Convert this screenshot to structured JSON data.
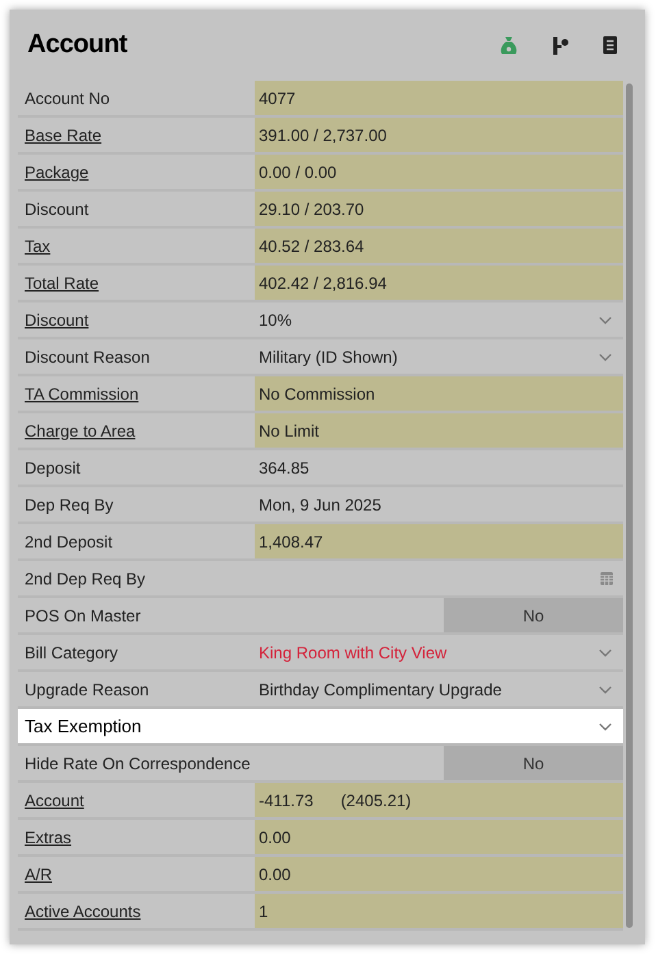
{
  "title": "Account",
  "rows": [
    {
      "label": "Account No",
      "link": false,
      "kind": "text",
      "value": "4077",
      "shaded": true,
      "alert": false,
      "focused": false
    },
    {
      "label": "Base Rate",
      "link": true,
      "kind": "text",
      "value": "391.00 / 2,737.00",
      "shaded": true,
      "alert": false,
      "focused": false
    },
    {
      "label": "Package",
      "link": true,
      "kind": "text",
      "value": "0.00 / 0.00",
      "shaded": true,
      "alert": false,
      "focused": false
    },
    {
      "label": "Discount",
      "link": false,
      "kind": "text",
      "value": "29.10 / 203.70",
      "shaded": true,
      "alert": false,
      "focused": false
    },
    {
      "label": "Tax",
      "link": true,
      "kind": "text",
      "value": "40.52 / 283.64",
      "shaded": true,
      "alert": false,
      "focused": false
    },
    {
      "label": "Total Rate",
      "link": true,
      "kind": "text",
      "value": "402.42 / 2,816.94",
      "shaded": true,
      "alert": false,
      "focused": false
    },
    {
      "label": "Discount",
      "link": true,
      "kind": "dropdown",
      "value": "10%",
      "shaded": false,
      "alert": false,
      "focused": false
    },
    {
      "label": "Discount Reason",
      "link": false,
      "kind": "dropdown",
      "value": "Military (ID Shown)",
      "shaded": false,
      "alert": false,
      "focused": false
    },
    {
      "label": "TA Commission",
      "link": true,
      "kind": "text",
      "value": "No Commission",
      "shaded": true,
      "alert": false,
      "focused": false
    },
    {
      "label": "Charge to Area",
      "link": true,
      "kind": "text",
      "value": "No Limit",
      "shaded": true,
      "alert": false,
      "focused": false
    },
    {
      "label": "Deposit",
      "link": false,
      "kind": "text",
      "value": "364.85",
      "shaded": false,
      "alert": false,
      "focused": false
    },
    {
      "label": "Dep Req By",
      "link": false,
      "kind": "text",
      "value": "Mon, 9 Jun 2025",
      "shaded": false,
      "alert": false,
      "focused": false
    },
    {
      "label": "2nd Deposit",
      "link": false,
      "kind": "text",
      "value": "1,408.47",
      "shaded": true,
      "alert": false,
      "focused": false
    },
    {
      "label": "2nd Dep Req By",
      "link": false,
      "kind": "date",
      "shaded": false,
      "focused": false
    },
    {
      "label": "POS On Master",
      "link": false,
      "kind": "toggle",
      "value": "No",
      "shaded": false,
      "alert": false,
      "focused": false
    },
    {
      "label": "Bill Category",
      "link": false,
      "kind": "dropdown",
      "value": "King Room with City View",
      "shaded": false,
      "alert": true,
      "focused": false
    },
    {
      "label": "Upgrade Reason",
      "link": false,
      "kind": "dropdown",
      "value": "Birthday Complimentary Upgrade",
      "shaded": false,
      "alert": false,
      "focused": false
    },
    {
      "label": "Tax Exemption",
      "link": false,
      "kind": "dropdown",
      "shaded": false,
      "focused": true
    },
    {
      "label": "Hide Rate On Correspondence",
      "link": false,
      "kind": "toggle",
      "value": "No",
      "shaded": false,
      "alert": false,
      "focused": false
    },
    {
      "label": "Account",
      "link": true,
      "kind": "text",
      "value": "-411.73",
      "value_2": "(2405.21)",
      "shaded": true,
      "alert": false,
      "focused": false
    },
    {
      "label": "Extras",
      "link": true,
      "kind": "text",
      "value": "0.00",
      "shaded": true,
      "alert": false,
      "focused": false
    },
    {
      "label": "A/R",
      "link": true,
      "kind": "text",
      "value": "0.00",
      "shaded": true,
      "alert": false,
      "focused": false
    },
    {
      "label": "Active Accounts",
      "link": true,
      "kind": "text",
      "value": "1",
      "shaded": true,
      "alert": false,
      "focused": false
    }
  ]
}
